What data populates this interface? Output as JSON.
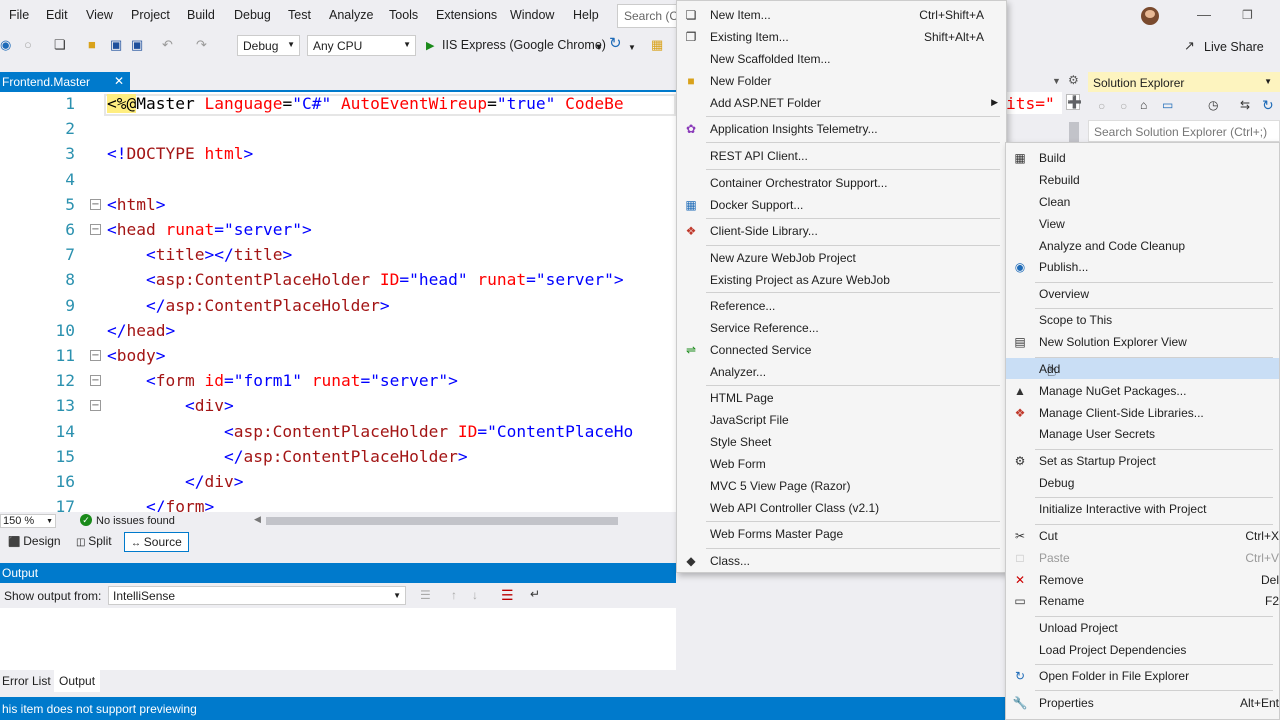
{
  "menubar": {
    "items": [
      "File",
      "Edit",
      "View",
      "Project",
      "Build",
      "Debug",
      "Test",
      "Analyze",
      "Tools",
      "Extensions",
      "Window",
      "Help"
    ],
    "search_placeholder": "Search (C"
  },
  "toolbar": {
    "config": "Debug",
    "platform": "Any CPU",
    "run_target": "IIS Express (Google Chrome)",
    "live_share": "Live Share"
  },
  "doc_tab": {
    "title": "Frontend.Master"
  },
  "editor": {
    "lines": [
      {
        "n": "1",
        "parts": [
          [
            "hl",
            "<%"
          ],
          [
            "hl",
            "@"
          ],
          [
            "",
            "Master "
          ],
          [
            "attr",
            "Language"
          ],
          [
            "",
            "="
          ],
          [
            "str",
            "\"C#\""
          ],
          [
            "",
            " "
          ],
          [
            "attr",
            "AutoEventWireup"
          ],
          [
            "",
            "="
          ],
          [
            "str",
            "\"true\""
          ],
          [
            "",
            " "
          ],
          [
            "attr",
            "CodeBe"
          ]
        ]
      },
      {
        "n": "2",
        "parts": []
      },
      {
        "n": "3",
        "parts": [
          [
            "blue",
            "<!"
          ],
          [
            "red",
            "DOCTYPE"
          ],
          [
            "",
            " "
          ],
          [
            "attr",
            "html"
          ],
          [
            "blue",
            ">"
          ]
        ]
      },
      {
        "n": "4",
        "parts": []
      },
      {
        "n": "5",
        "parts": [
          [
            "blue",
            "<"
          ],
          [
            "red",
            "html"
          ],
          [
            "blue",
            ">"
          ]
        ]
      },
      {
        "n": "6",
        "parts": [
          [
            "blue",
            "<"
          ],
          [
            "red",
            "head"
          ],
          [
            "",
            " "
          ],
          [
            "attr",
            "runat"
          ],
          [
            "blue",
            "="
          ],
          [
            "str",
            "\"server\""
          ],
          [
            "blue",
            ">"
          ]
        ]
      },
      {
        "n": "7",
        "parts": [
          [
            "",
            "    "
          ],
          [
            "blue",
            "<"
          ],
          [
            "red",
            "title"
          ],
          [
            "blue",
            "></"
          ],
          [
            "red",
            "title"
          ],
          [
            "blue",
            ">"
          ]
        ]
      },
      {
        "n": "8",
        "parts": [
          [
            "",
            "    "
          ],
          [
            "blue",
            "<"
          ],
          [
            "red",
            "asp:ContentPlaceHolder"
          ],
          [
            "",
            " "
          ],
          [
            "attr",
            "ID"
          ],
          [
            "blue",
            "="
          ],
          [
            "str",
            "\"head\""
          ],
          [
            "",
            " "
          ],
          [
            "attr",
            "runat"
          ],
          [
            "blue",
            "="
          ],
          [
            "str",
            "\"server\""
          ],
          [
            "blue",
            ">"
          ]
        ]
      },
      {
        "n": "9",
        "parts": [
          [
            "",
            "    "
          ],
          [
            "blue",
            "</"
          ],
          [
            "red",
            "asp:ContentPlaceHolder"
          ],
          [
            "blue",
            ">"
          ]
        ]
      },
      {
        "n": "10",
        "parts": [
          [
            "blue",
            "</"
          ],
          [
            "red",
            "head"
          ],
          [
            "blue",
            ">"
          ]
        ]
      },
      {
        "n": "11",
        "parts": [
          [
            "blue",
            "<"
          ],
          [
            "red",
            "body"
          ],
          [
            "blue",
            ">"
          ]
        ]
      },
      {
        "n": "12",
        "parts": [
          [
            "",
            "    "
          ],
          [
            "blue",
            "<"
          ],
          [
            "red",
            "form"
          ],
          [
            "",
            " "
          ],
          [
            "attr",
            "id"
          ],
          [
            "blue",
            "="
          ],
          [
            "str",
            "\"form1\""
          ],
          [
            "",
            " "
          ],
          [
            "attr",
            "runat"
          ],
          [
            "blue",
            "="
          ],
          [
            "str",
            "\"server\""
          ],
          [
            "blue",
            ">"
          ]
        ]
      },
      {
        "n": "13",
        "parts": [
          [
            "",
            "        "
          ],
          [
            "blue",
            "<"
          ],
          [
            "red",
            "div"
          ],
          [
            "blue",
            ">"
          ]
        ]
      },
      {
        "n": "14",
        "parts": [
          [
            "",
            "            "
          ],
          [
            "blue",
            "<"
          ],
          [
            "red",
            "asp:ContentPlaceHolder"
          ],
          [
            "",
            " "
          ],
          [
            "attr",
            "ID"
          ],
          [
            "blue",
            "="
          ],
          [
            "str",
            "\"ContentPlaceHo"
          ]
        ]
      },
      {
        "n": "15",
        "parts": [
          [
            "",
            "            "
          ],
          [
            "blue",
            "</"
          ],
          [
            "red",
            "asp:ContentPlaceHolder"
          ],
          [
            "blue",
            ">"
          ]
        ]
      },
      {
        "n": "16",
        "parts": [
          [
            "",
            "        "
          ],
          [
            "blue",
            "</"
          ],
          [
            "red",
            "div"
          ],
          [
            "blue",
            ">"
          ]
        ]
      },
      {
        "n": "17",
        "parts": [
          [
            "",
            "    "
          ],
          [
            "blue",
            "</"
          ],
          [
            "red",
            "form"
          ],
          [
            "blue",
            ">"
          ]
        ]
      }
    ],
    "tail_text": "its=\""
  },
  "status_strip": {
    "zoom": "150 %",
    "issues": "No issues found"
  },
  "view_tabs": [
    "Design",
    "Split",
    "Source"
  ],
  "output": {
    "title": "Output",
    "show_from_label": "Show output from:",
    "show_from_value": "IntelliSense"
  },
  "bottom_tabs": [
    "Error List",
    "Output"
  ],
  "statusbar": {
    "text": "his item does not support previewing"
  },
  "solution_explorer": {
    "title": "Solution Explorer",
    "search_placeholder": "Search Solution Explorer (Ctrl+;)"
  },
  "add_submenu": {
    "items": [
      {
        "label": "New Item...",
        "shortcut": "Ctrl+Shift+A",
        "icon": "new-item-icon"
      },
      {
        "label": "Existing Item...",
        "shortcut": "Shift+Alt+A",
        "icon": "existing-item-icon"
      },
      {
        "label": "New Scaffolded Item..."
      },
      {
        "label": "New Folder",
        "icon": "folder-icon"
      },
      {
        "label": "Add ASP.NET Folder",
        "submenu": true
      },
      {
        "label": "Application Insights Telemetry...",
        "icon": "insights-icon"
      },
      {
        "label": "REST API Client..."
      },
      {
        "label": "Container Orchestrator Support..."
      },
      {
        "label": "Docker Support...",
        "icon": "docker-icon"
      },
      {
        "label": "Client-Side Library...",
        "icon": "library-icon"
      },
      {
        "label": "New Azure WebJob Project"
      },
      {
        "label": "Existing Project as Azure WebJob"
      },
      {
        "label": "Reference..."
      },
      {
        "label": "Service Reference..."
      },
      {
        "label": "Connected Service",
        "icon": "connected-service-icon"
      },
      {
        "label": "Analyzer..."
      },
      {
        "label": "HTML Page"
      },
      {
        "label": "JavaScript File"
      },
      {
        "label": "Style Sheet"
      },
      {
        "label": "Web Form"
      },
      {
        "label": "MVC 5 View Page (Razor)"
      },
      {
        "label": "Web API Controller Class (v2.1)"
      },
      {
        "label": "Web Forms Master Page"
      },
      {
        "label": "Class...",
        "icon": "class-icon"
      }
    ]
  },
  "context_menu": {
    "items": [
      {
        "label": "Build",
        "icon": "build-icon"
      },
      {
        "label": "Rebuild"
      },
      {
        "label": "Clean"
      },
      {
        "label": "View"
      },
      {
        "label": "Analyze and Code Cleanup"
      },
      {
        "label": "Publish...",
        "icon": "globe-icon"
      },
      {
        "label": "Overview"
      },
      {
        "label": "Scope to This"
      },
      {
        "label": "New Solution Explorer View",
        "icon": "solution-view-icon"
      },
      {
        "label": "Add"
      },
      {
        "label": "Manage NuGet Packages...",
        "icon": "nuget-icon"
      },
      {
        "label": "Manage Client-Side Libraries...",
        "icon": "library-icon"
      },
      {
        "label": "Manage User Secrets"
      },
      {
        "label": "Set as Startup Project",
        "icon": "gear-icon"
      },
      {
        "label": "Debug"
      },
      {
        "label": "Initialize Interactive with Project"
      },
      {
        "label": "Cut",
        "shortcut": "Ctrl+X",
        "icon": "scissors-icon"
      },
      {
        "label": "Paste",
        "shortcut": "Ctrl+V",
        "icon": "paste-icon",
        "disabled": true
      },
      {
        "label": "Remove",
        "shortcut": "Del",
        "icon": "remove-icon"
      },
      {
        "label": "Rename",
        "shortcut": "F2",
        "icon": "rename-icon"
      },
      {
        "label": "Unload Project"
      },
      {
        "label": "Load Project Dependencies"
      },
      {
        "label": "Open Folder in File Explorer",
        "icon": "refresh-arrow-icon"
      },
      {
        "label": "Properties",
        "shortcut": "Alt+Ent",
        "icon": "wrench-icon"
      }
    ]
  },
  "colors": {
    "accent": "#007acc",
    "se_header": "#fdf4bf",
    "hover": "#c9def5"
  }
}
